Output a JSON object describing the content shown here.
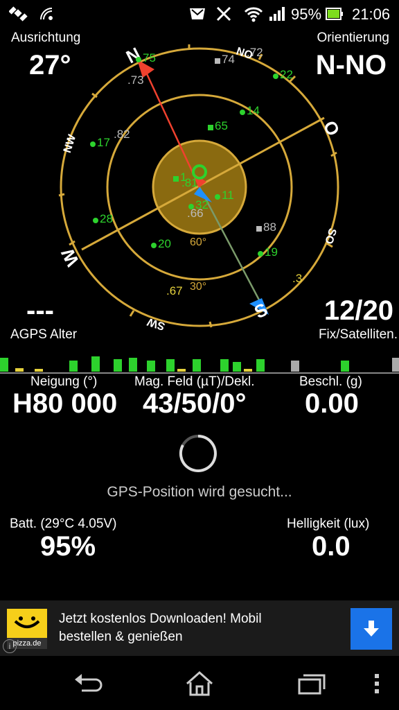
{
  "status_bar": {
    "battery_percent": "95%",
    "time": "21:06",
    "icons": [
      "gps-satellite-icon",
      "wifi-broadcast-icon",
      "mail-icon",
      "no-signal-icon",
      "wifi-icon",
      "signal-bars-icon",
      "battery-icon"
    ]
  },
  "header": {
    "left_label": "Ausrichtung",
    "left_value": "27°",
    "right_label": "Orientierung",
    "right_value": "N-NO"
  },
  "compass": {
    "directions": {
      "n": "N",
      "ne": "NO",
      "e": "O",
      "se": "SO",
      "s": "S",
      "sw": "SW",
      "w": "W",
      "nw": "NW"
    },
    "elevation_labels": [
      "60°",
      "30°"
    ],
    "satellites": [
      {
        "id": "75",
        "color": "#2dd22d"
      },
      {
        "id": "73",
        "color": "#bbbbbb"
      },
      {
        "id": "74",
        "color": "#bbbbbb"
      },
      {
        "id": "72",
        "color": "#bbbbbb"
      },
      {
        "id": "22",
        "color": "#2dd22d"
      },
      {
        "id": "14",
        "color": "#2dd22d"
      },
      {
        "id": "65",
        "color": "#2dd22d"
      },
      {
        "id": "17",
        "color": "#2dd22d"
      },
      {
        "id": "82",
        "color": "#bbbbbb"
      },
      {
        "id": "1",
        "color": "#2dd22d"
      },
      {
        "id": "81",
        "color": "#2dd22d"
      },
      {
        "id": "11",
        "color": "#2dd22d"
      },
      {
        "id": "32",
        "color": "#2dd22d"
      },
      {
        "id": "66",
        "color": "#bbbbbb"
      },
      {
        "id": "28",
        "color": "#2dd22d"
      },
      {
        "id": "88",
        "color": "#bbbbbb"
      },
      {
        "id": "20",
        "color": "#2dd22d"
      },
      {
        "id": "19",
        "color": "#2dd22d"
      },
      {
        "id": "67",
        "color": "#e6d23c"
      },
      {
        "id": "3",
        "color": "#e6d23c"
      }
    ]
  },
  "left_info": {
    "value": "---",
    "label": "AGPS Alter"
  },
  "right_info": {
    "value": "12/20",
    "label": "Fix/Satelliten."
  },
  "signal_bars": [
    {
      "color": "#2dd22d",
      "level": 0.55
    },
    {
      "color": "#e6d23c",
      "level": 0.15
    },
    {
      "color": "#e6d23c",
      "level": 0.1
    },
    {
      "color": "#2dd22d",
      "level": 0.45
    },
    {
      "color": "#2dd22d",
      "level": 0.6
    },
    {
      "color": "#2dd22d",
      "level": 0.5
    },
    {
      "color": "#2dd22d",
      "level": 0.55
    },
    {
      "color": "#2dd22d",
      "level": 0.45
    },
    {
      "color": "#2dd22d",
      "level": 0.5
    },
    {
      "color": "#e6d23c",
      "level": 0.1
    },
    {
      "color": "#2dd22d",
      "level": 0.5
    },
    {
      "color": "#2dd22d",
      "level": 0.5
    },
    {
      "color": "#2dd22d",
      "level": 0.4
    },
    {
      "color": "#e6d23c",
      "level": 0.1
    },
    {
      "color": "#2dd22d",
      "level": 0.5
    },
    {
      "color": "#aaaaaa",
      "level": 0.45
    },
    {
      "color": "#2dd22d",
      "level": 0.45
    },
    {
      "color": "#aaaaaa",
      "level": 0.55
    }
  ],
  "metrics": {
    "tilt_label": "Neigung (°)",
    "tilt_value": "H80 000",
    "mag_label": "Mag. Feld (µT)/Dekl.",
    "mag_value": "43/50/0°",
    "accel_label": "Beschl. (g)",
    "accel_value": "0.00"
  },
  "gps_status": "GPS-Position wird gesucht...",
  "battery": {
    "label": "Batt. (29°C 4.05V)",
    "value": "95%"
  },
  "brightness": {
    "label": "Helligkeit (lux)",
    "value": "0.0"
  },
  "ad": {
    "logo_text": "pizza.de",
    "text_line1": "Jetzt kostenlos Downloaden! Mobil",
    "text_line2": "bestellen & genießen",
    "button_color": "#1a73e8"
  },
  "colors": {
    "ring": "#d6a93a",
    "center_disc": "#8a6a10",
    "needle_north": "#f0412e",
    "needle_south": "#1e90ff"
  }
}
